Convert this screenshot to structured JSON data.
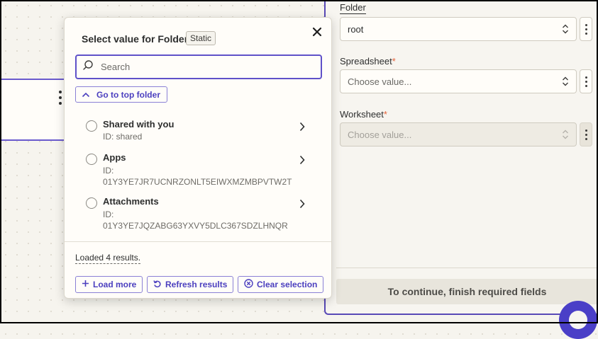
{
  "popover": {
    "title": "Select value for Folder",
    "badge": "Static",
    "search_placeholder": "Search",
    "top_folder_label": "Go to top folder",
    "items": [
      {
        "name": "Shared with you",
        "id": "ID: shared"
      },
      {
        "name": "Apps",
        "id": "ID:\n01Y3YE7JR7UCNRZONLT5EIWXMZMBPVTW2T"
      },
      {
        "name": "Attachments",
        "id": "ID:\n01Y3YE7JQZABG63YXVY5DLC367SDZLHNQR"
      }
    ],
    "loaded_text": "Loaded 4 results.",
    "footer": {
      "load_more": "Load more",
      "refresh": "Refresh results",
      "clear": "Clear selection"
    }
  },
  "fields": {
    "folder": {
      "label": "Folder",
      "value": "root"
    },
    "spreadsheet": {
      "label": "Spreadsheet",
      "required": "*",
      "placeholder": "Choose value..."
    },
    "worksheet": {
      "label": "Worksheet",
      "required": "*",
      "placeholder": "Choose value..."
    }
  },
  "continue_label": "To continue, finish required fields",
  "colors": {
    "accent": "#5f51c9",
    "required": "#e5633a",
    "background": "#f6f4ee"
  },
  "icons": [
    "close-icon",
    "search-icon",
    "chevron-up-icon",
    "chevron-right-icon",
    "plus-icon",
    "refresh-icon",
    "clear-icon",
    "updown-icon",
    "kebab-icon"
  ]
}
